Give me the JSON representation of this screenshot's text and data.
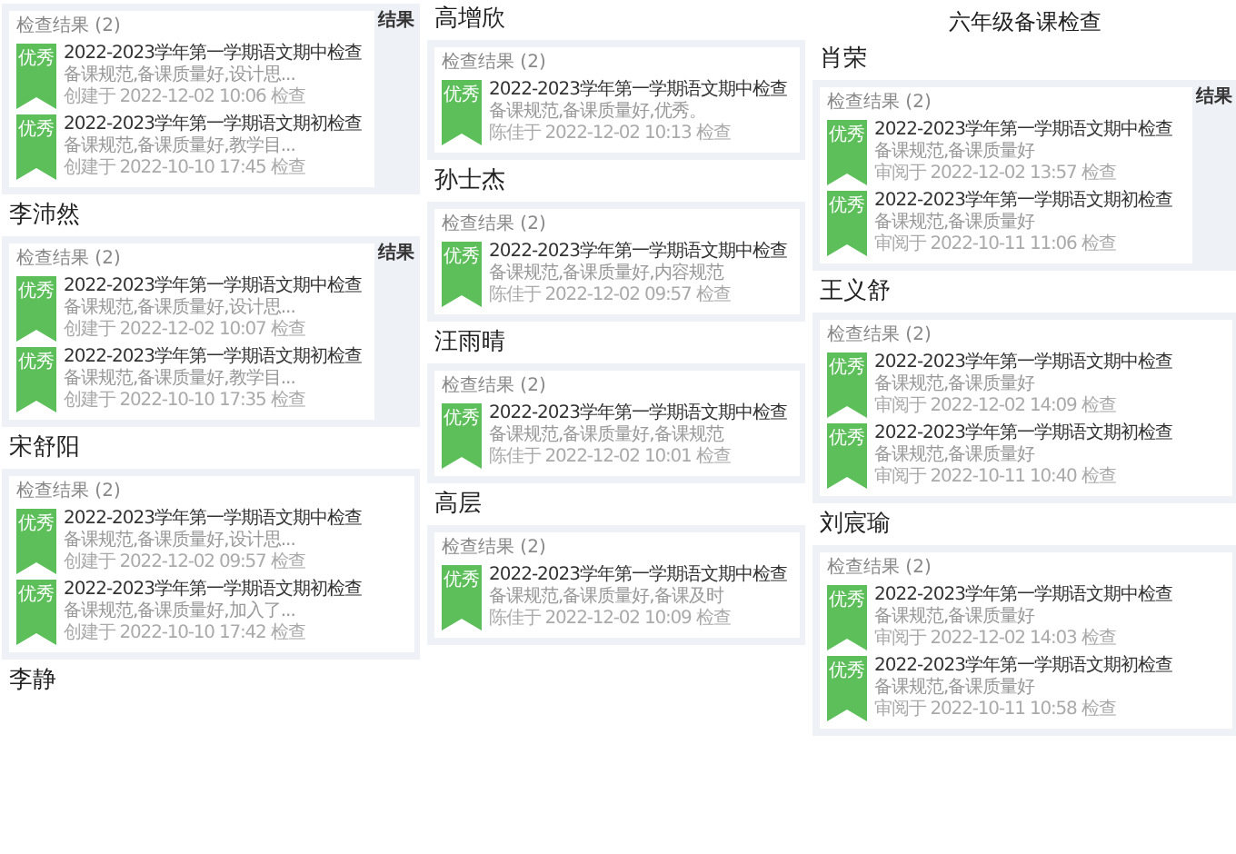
{
  "columns": [
    {
      "items": [
        {
          "kind": "panel",
          "header": "检查结果 (2)",
          "side_label": "结果",
          "entries": [
            {
              "badge": "优秀",
              "title": "2022-2023学年第一学期语文期中检查",
              "note": "备课规范,备课质量好,设计思...",
              "meta": "创建于 2022-12-02 10:06 检查"
            },
            {
              "badge": "优秀",
              "title": "2022-2023学年第一学期语文期初检查",
              "note": "备课规范,备课质量好,教学目...",
              "meta": "创建于 2022-10-10 17:45 检查"
            }
          ]
        },
        {
          "kind": "name",
          "text": "李沛然"
        },
        {
          "kind": "panel",
          "header": "检查结果 (2)",
          "side_label": "结果",
          "entries": [
            {
              "badge": "优秀",
              "title": "2022-2023学年第一学期语文期中检查",
              "note": "备课规范,备课质量好,设计思...",
              "meta": "创建于 2022-12-02 10:07 检查"
            },
            {
              "badge": "优秀",
              "title": "2022-2023学年第一学期语文期初检查",
              "note": "备课规范,备课质量好,教学目...",
              "meta": "创建于 2022-10-10 17:35 检查"
            }
          ]
        },
        {
          "kind": "name",
          "text": "宋舒阳"
        },
        {
          "kind": "panel",
          "header": "检查结果 (2)",
          "entries": [
            {
              "badge": "优秀",
              "title": "2022-2023学年第一学期语文期中检查",
              "note": "备课规范,备课质量好,设计思...",
              "meta": "创建于 2022-12-02 09:57 检查"
            },
            {
              "badge": "优秀",
              "title": "2022-2023学年第一学期语文期初检查",
              "note": "备课规范,备课质量好,加入了...",
              "meta": "创建于 2022-10-10 17:42 检查"
            }
          ]
        },
        {
          "kind": "name",
          "text": "李静"
        }
      ]
    },
    {
      "items": [
        {
          "kind": "name",
          "text": "高增欣"
        },
        {
          "kind": "panel",
          "header": "检查结果 (2)",
          "entries": [
            {
              "badge": "优秀",
              "title": "2022-2023学年第一学期语文期中检查",
              "note": "备课规范,备课质量好,优秀。",
              "meta": "陈佳于 2022-12-02 10:13 检查"
            }
          ]
        },
        {
          "kind": "name",
          "text": "孙士杰"
        },
        {
          "kind": "panel",
          "header": "检查结果 (2)",
          "entries": [
            {
              "badge": "优秀",
              "title": "2022-2023学年第一学期语文期中检查",
              "note": "备课规范,备课质量好,内容规范",
              "meta": "陈佳于 2022-12-02 09:57 检查"
            }
          ]
        },
        {
          "kind": "name",
          "text": "汪雨晴"
        },
        {
          "kind": "panel",
          "header": "检查结果 (2)",
          "entries": [
            {
              "badge": "优秀",
              "title": "2022-2023学年第一学期语文期中检查",
              "note": "备课规范,备课质量好,备课规范",
              "meta": "陈佳于 2022-12-02 10:01 检查"
            }
          ]
        },
        {
          "kind": "name",
          "text": "高层"
        },
        {
          "kind": "panel",
          "header": "检查结果 (2)",
          "entries": [
            {
              "badge": "优秀",
              "title": "2022-2023学年第一学期语文期中检查",
              "note": "备课规范,备课质量好,备课及时",
              "meta": "陈佳于 2022-12-02 10:09 检查"
            }
          ]
        }
      ]
    },
    {
      "heading": "六年级备课检查",
      "items": [
        {
          "kind": "name",
          "text": "肖荣"
        },
        {
          "kind": "panel",
          "header": "检查结果 (2)",
          "side_label": "结果",
          "entries": [
            {
              "badge": "优秀",
              "title": "2022-2023学年第一学期语文期中检查",
              "note": "备课规范,备课质量好",
              "meta": "审阅于 2022-12-02 13:57 检查"
            },
            {
              "badge": "优秀",
              "title": "2022-2023学年第一学期语文期初检查",
              "note": "备课规范,备课质量好",
              "meta": "审阅于 2022-10-11 11:06 检查"
            }
          ]
        },
        {
          "kind": "name",
          "text": "王义舒"
        },
        {
          "kind": "panel",
          "header": "检查结果 (2)",
          "entries": [
            {
              "badge": "优秀",
              "title": "2022-2023学年第一学期语文期中检查",
              "note": "备课规范,备课质量好",
              "meta": "审阅于 2022-12-02 14:09 检查"
            },
            {
              "badge": "优秀",
              "title": "2022-2023学年第一学期语文期初检查",
              "note": "备课规范,备课质量好",
              "meta": "审阅于 2022-10-11 10:40 检查"
            }
          ]
        },
        {
          "kind": "name",
          "text": "刘宸瑜"
        },
        {
          "kind": "panel",
          "header": "检查结果 (2)",
          "entries": [
            {
              "badge": "优秀",
              "title": "2022-2023学年第一学期语文期中检查",
              "note": "备课规范,备课质量好",
              "meta": "审阅于 2022-12-02 14:03 检查"
            },
            {
              "badge": "优秀",
              "title": "2022-2023学年第一学期语文期初检查",
              "note": "备课规范,备课质量好",
              "meta": "审阅于 2022-10-11 10:58 检查"
            }
          ]
        }
      ]
    }
  ]
}
